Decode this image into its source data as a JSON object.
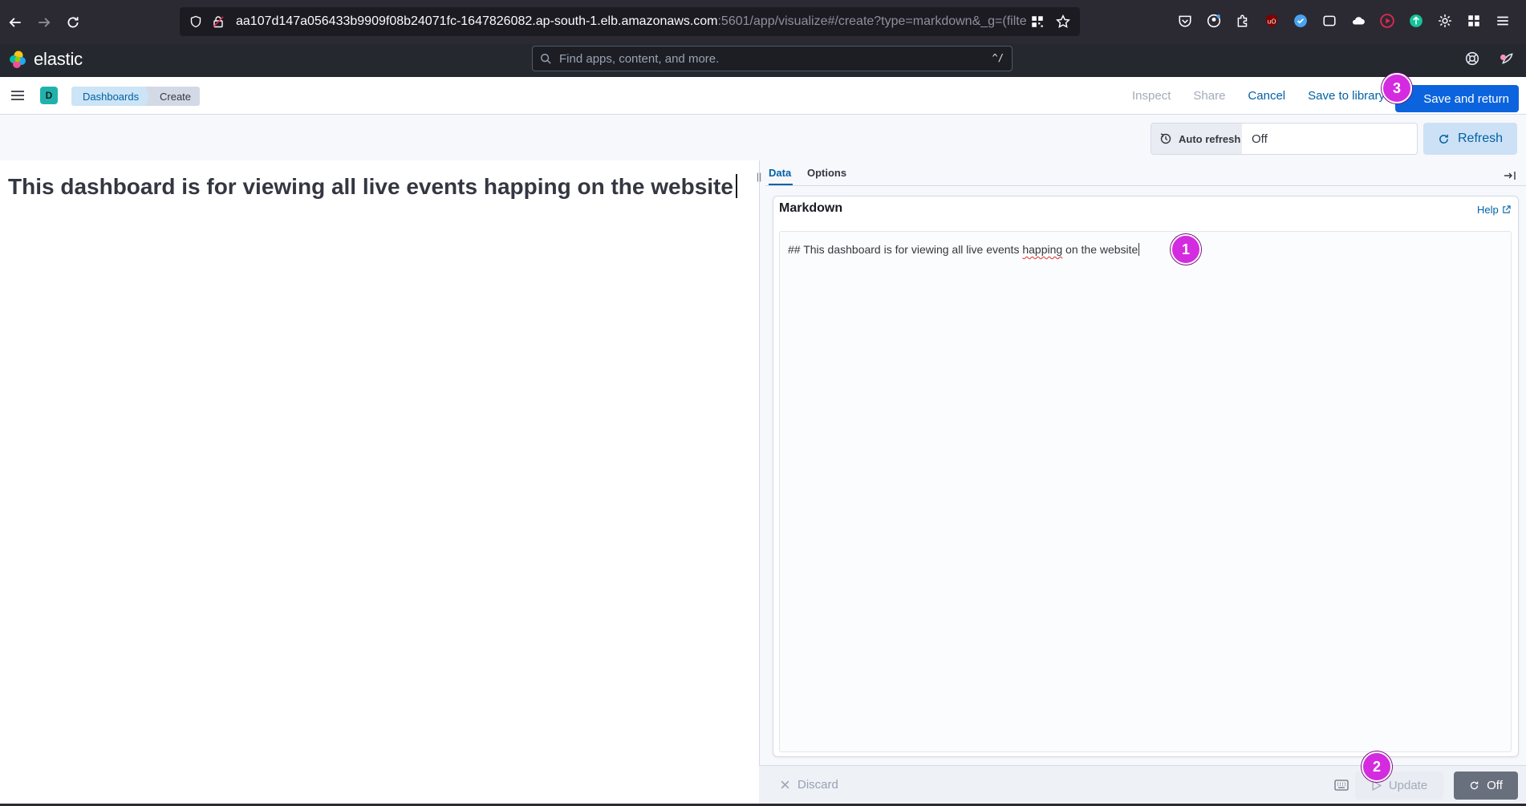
{
  "browser": {
    "url_main": "aa107d147a056433b9909f08b24071fc-1647826082.ap-south-1.elb.amazonaws.com",
    "url_rest": ":5601/app/visualize#/create?type=markdown&_g=(filte"
  },
  "kibana": {
    "logo_text": "elastic",
    "search_placeholder": "Find apps, content, and more.",
    "search_shortcut": "^/"
  },
  "appbar": {
    "space_initial": "D",
    "breadcrumbs": [
      "Dashboards",
      "Create"
    ],
    "links": {
      "inspect": "Inspect",
      "share": "Share",
      "cancel": "Cancel",
      "save_to_library": "Save to library"
    },
    "save_and_return": "Save and return"
  },
  "toolbar": {
    "auto_refresh_label": "Auto refresh",
    "auto_refresh_value": "Off",
    "refresh_label": "Refresh"
  },
  "preview": {
    "heading": "This dashboard is for viewing all live events happing on the website"
  },
  "editor": {
    "tabs": [
      "Data",
      "Options"
    ],
    "active_tab": "Data",
    "section_title": "Markdown",
    "help_label": "Help",
    "text_before": "## This dashboard is for viewing all live events ",
    "text_misspelled": "happing",
    "text_after": " on the website"
  },
  "bottom": {
    "discard_label": "Discard",
    "update_label": "Update",
    "off_label": "Off"
  },
  "markers": [
    "1",
    "2",
    "3"
  ],
  "colors": {
    "accent": "#0b64dd",
    "marker": "#d42be0",
    "space_avatar": "#20b2aa"
  }
}
